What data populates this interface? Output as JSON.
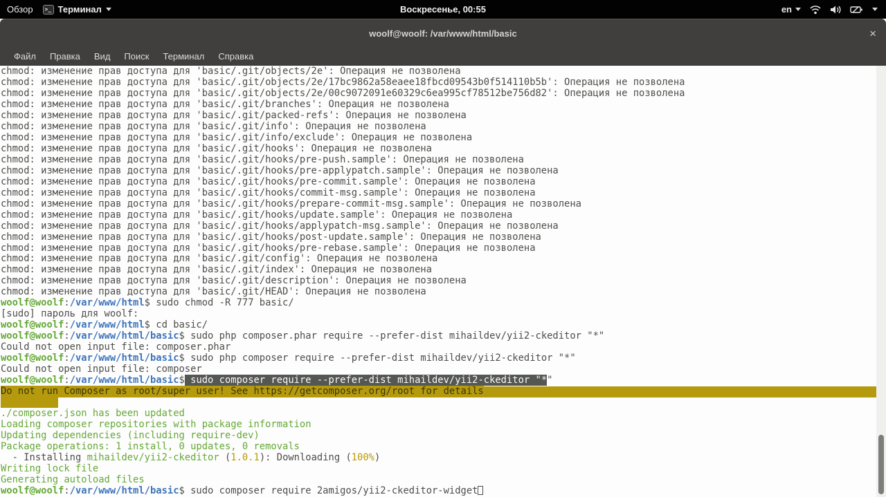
{
  "top_bar": {
    "activities": "Обзор",
    "app_name": "Терминал",
    "clock": "Воскресенье, 00:55",
    "keyboard_layout": "en",
    "status_icons": [
      "terminal-app-icon",
      "wifi-icon",
      "volume-icon",
      "battery-icon",
      "menu-caret-icon"
    ]
  },
  "window": {
    "title": "woolf@woolf: /var/www/html/basic",
    "close_label": "×",
    "menu": [
      "Файл",
      "Правка",
      "Вид",
      "Поиск",
      "Терминал",
      "Справка"
    ]
  },
  "colors": {
    "topbar-bg": "#020202",
    "topbar-fg": "#f0f0f0",
    "chrome": "#403f3d",
    "term-bg": "#fdfdfd",
    "fg": "#4d4d4b",
    "green": "#65a836",
    "blue": "#3d74bc",
    "yellow": "#b79b00",
    "warn-bg": "#b59a0e",
    "warn-fg": "#3b3606",
    "sel-bg": "#555753",
    "sel-fg": "#fbfbfb",
    "gutter": "#f0f0ee",
    "thumb": "#7d7d7b"
  },
  "terminal": {
    "lines": [
      {
        "segs": [
          [
            "chmod: изменение прав доступа для 'basic/.git/objects/2e': Операция не позволена",
            "d"
          ]
        ]
      },
      {
        "segs": [
          [
            "chmod: изменение прав доступа для 'basic/.git/objects/2e/17bc9862a58eaee18fbcd09543b0f514110b5b': Операция не позволена",
            "d"
          ]
        ]
      },
      {
        "segs": [
          [
            "chmod: изменение прав доступа для 'basic/.git/objects/2e/00c9072091e60329c6ea995cf78512be756d82': Операция не позволена",
            "d"
          ]
        ]
      },
      {
        "segs": [
          [
            "chmod: изменение прав доступа для 'basic/.git/branches': Операция не позволена",
            "d"
          ]
        ]
      },
      {
        "segs": [
          [
            "chmod: изменение прав доступа для 'basic/.git/packed-refs': Операция не позволена",
            "d"
          ]
        ]
      },
      {
        "segs": [
          [
            "chmod: изменение прав доступа для 'basic/.git/info': Операция не позволена",
            "d"
          ]
        ]
      },
      {
        "segs": [
          [
            "chmod: изменение прав доступа для 'basic/.git/info/exclude': Операция не позволена",
            "d"
          ]
        ]
      },
      {
        "segs": [
          [
            "chmod: изменение прав доступа для 'basic/.git/hooks': Операция не позволена",
            "d"
          ]
        ]
      },
      {
        "segs": [
          [
            "chmod: изменение прав доступа для 'basic/.git/hooks/pre-push.sample': Операция не позволена",
            "d"
          ]
        ]
      },
      {
        "segs": [
          [
            "chmod: изменение прав доступа для 'basic/.git/hooks/pre-applypatch.sample': Операция не позволена",
            "d"
          ]
        ]
      },
      {
        "segs": [
          [
            "chmod: изменение прав доступа для 'basic/.git/hooks/pre-commit.sample': Операция не позволена",
            "d"
          ]
        ]
      },
      {
        "segs": [
          [
            "chmod: изменение прав доступа для 'basic/.git/hooks/commit-msg.sample': Операция не позволена",
            "d"
          ]
        ]
      },
      {
        "segs": [
          [
            "chmod: изменение прав доступа для 'basic/.git/hooks/prepare-commit-msg.sample': Операция не позволена",
            "d"
          ]
        ]
      },
      {
        "segs": [
          [
            "chmod: изменение прав доступа для 'basic/.git/hooks/update.sample': Операция не позволена",
            "d"
          ]
        ]
      },
      {
        "segs": [
          [
            "chmod: изменение прав доступа для 'basic/.git/hooks/applypatch-msg.sample': Операция не позволена",
            "d"
          ]
        ]
      },
      {
        "segs": [
          [
            "chmod: изменение прав доступа для 'basic/.git/hooks/post-update.sample': Операция не позволена",
            "d"
          ]
        ]
      },
      {
        "segs": [
          [
            "chmod: изменение прав доступа для 'basic/.git/hooks/pre-rebase.sample': Операция не позволена",
            "d"
          ]
        ]
      },
      {
        "segs": [
          [
            "chmod: изменение прав доступа для 'basic/.git/config': Операция не позволена",
            "d"
          ]
        ]
      },
      {
        "segs": [
          [
            "chmod: изменение прав доступа для 'basic/.git/index': Операция не позволена",
            "d"
          ]
        ]
      },
      {
        "segs": [
          [
            "chmod: изменение прав доступа для 'basic/.git/description': Операция не позволена",
            "d"
          ]
        ]
      },
      {
        "segs": [
          [
            "chmod: изменение прав доступа для 'basic/.git/HEAD': Операция не позволена",
            "d"
          ]
        ]
      },
      {
        "segs": [
          [
            "woolf@woolf",
            "p"
          ],
          [
            ":",
            "d"
          ],
          [
            "/var/www/html",
            "b"
          ],
          [
            "$ sudo chmod -R 777 basic/",
            "d"
          ]
        ]
      },
      {
        "segs": [
          [
            "[sudo] пароль для woolf: ",
            "d"
          ]
        ]
      },
      {
        "segs": [
          [
            "woolf@woolf",
            "p"
          ],
          [
            ":",
            "d"
          ],
          [
            "/var/www/html",
            "b"
          ],
          [
            "$ cd basic/",
            "d"
          ]
        ]
      },
      {
        "segs": [
          [
            "woolf@woolf",
            "p"
          ],
          [
            ":",
            "d"
          ],
          [
            "/var/www/html/basic",
            "b"
          ],
          [
            "$ sudo php composer.phar require --prefer-dist mihaildev/yii2-ckeditor \"*\"",
            "d"
          ]
        ]
      },
      {
        "segs": [
          [
            "Could not open input file: composer.phar",
            "d"
          ]
        ]
      },
      {
        "segs": [
          [
            "woolf@woolf",
            "p"
          ],
          [
            ":",
            "d"
          ],
          [
            "/var/www/html/basic",
            "b"
          ],
          [
            "$ sudo php composer require --prefer-dist mihaildev/yii2-ckeditor \"*\"",
            "d"
          ]
        ]
      },
      {
        "segs": [
          [
            "Could not open input file: composer",
            "d"
          ]
        ]
      },
      {
        "segs": [
          [
            "woolf@woolf",
            "p"
          ],
          [
            ":",
            "d"
          ],
          [
            "/var/www/html/basic",
            "b"
          ],
          [
            "$",
            "d"
          ],
          [
            " sudo composer require --prefer-dist mihaildev/yii2-ckeditor \"*",
            "s"
          ],
          [
            "\"",
            "d"
          ]
        ]
      },
      {
        "bg": "warn",
        "segs": [
          [
            "Do not run Composer as root/super user! See https://getcomposer.org/root for details",
            "w"
          ]
        ]
      },
      {
        "segs": [
          [
            "          ",
            "w"
          ]
        ]
      },
      {
        "segs": [
          [
            "./composer.json has been updated",
            "g"
          ]
        ]
      },
      {
        "segs": [
          [
            "Loading composer repositories with package information",
            "g"
          ]
        ]
      },
      {
        "segs": [
          [
            "Updating dependencies (including require-dev)",
            "g"
          ]
        ]
      },
      {
        "segs": [
          [
            "Package operations: 1 install, 0 updates, 0 removals",
            "g"
          ]
        ]
      },
      {
        "segs": [
          [
            "  - Installing ",
            "d"
          ],
          [
            "mihaildev/yii2-ckeditor",
            "g"
          ],
          [
            " (",
            "d"
          ],
          [
            "1.0.1",
            "y"
          ],
          [
            "): Downloading (",
            "d"
          ],
          [
            "100%",
            "y"
          ],
          [
            ")",
            "d"
          ]
        ]
      },
      {
        "segs": [
          [
            "Writing lock file",
            "g"
          ]
        ]
      },
      {
        "segs": [
          [
            "Generating autoload files",
            "g"
          ]
        ]
      },
      {
        "cursor": true,
        "segs": [
          [
            "woolf@woolf",
            "p"
          ],
          [
            ":",
            "d"
          ],
          [
            "/var/www/html/basic",
            "b"
          ],
          [
            "$ sudo composer require 2amigos/yii2-ckeditor-widget",
            "d"
          ]
        ]
      }
    ]
  }
}
